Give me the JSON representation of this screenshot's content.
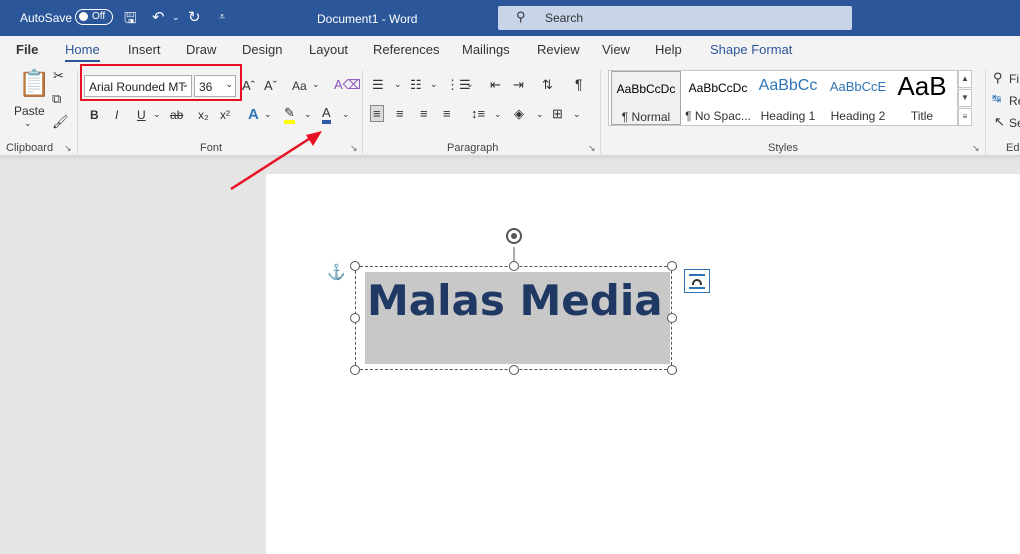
{
  "titlebar": {
    "autosave_label": "AutoSave",
    "autosave_state": "Off",
    "doc_title": "Document1  -  Word",
    "search_placeholder": "Search"
  },
  "menu": {
    "file": "File",
    "home": "Home",
    "insert": "Insert",
    "draw": "Draw",
    "design": "Design",
    "layout": "Layout",
    "references": "References",
    "mailings": "Mailings",
    "review": "Review",
    "view": "View",
    "help": "Help",
    "shape_format": "Shape Format"
  },
  "clipboard": {
    "paste_label": "Paste",
    "group_label": "Clipboard"
  },
  "font": {
    "font_name": "Arial Rounded MT",
    "font_size": "36",
    "group_label": "Font",
    "grow": "Aˆ",
    "shrink": "Aˇ",
    "change_case": "Aa",
    "bold": "B",
    "italic": "I",
    "underline": "U",
    "strike": "ab",
    "subscript": "x₂",
    "superscript": "x²",
    "text_effects": "A",
    "highlight": "✎",
    "font_color": "A"
  },
  "paragraph": {
    "group_label": "Paragraph",
    "show_marks": "¶"
  },
  "styles": {
    "group_label": "Styles",
    "items": [
      {
        "preview": "AaBbCcDc",
        "name": "¶ Normal"
      },
      {
        "preview": "AaBbCcDc",
        "name": "¶ No Spac..."
      },
      {
        "preview": "AaBbCc",
        "name": "Heading 1"
      },
      {
        "preview": "AaBbCcE",
        "name": "Heading 2"
      },
      {
        "preview": "AaB",
        "name": "Title"
      }
    ]
  },
  "editing": {
    "find": "Fi",
    "replace": "Re",
    "select": "Se",
    "group_label": "Ed"
  },
  "document": {
    "textbox_text": "Malas Media"
  },
  "colors": {
    "accent": "#2b579a",
    "annotation_red": "#e81123",
    "text_dark_blue": "#203864"
  }
}
